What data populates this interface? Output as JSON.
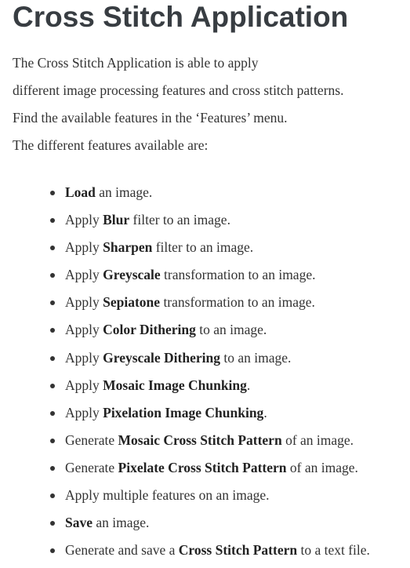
{
  "title": "Cross Stitch Application",
  "intro": [
    "The Cross Stitch Application is able to apply",
    "different image processing features and cross stitch patterns.",
    "Find the available features in the ‘Features’ menu.",
    "The different features available are:"
  ],
  "features": [
    {
      "before": "",
      "bold": "Load",
      "after": " an image."
    },
    {
      "before": "Apply ",
      "bold": "Blur",
      "after": " filter to an image."
    },
    {
      "before": "Apply ",
      "bold": "Sharpen",
      "after": " filter to an image."
    },
    {
      "before": "Apply ",
      "bold": "Greyscale",
      "after": " transformation to an image."
    },
    {
      "before": "Apply ",
      "bold": "Sepiatone",
      "after": " transformation to an image."
    },
    {
      "before": "Apply ",
      "bold": "Color Dithering",
      "after": " to an image."
    },
    {
      "before": "Apply ",
      "bold": "Greyscale Dithering",
      "after": " to an image."
    },
    {
      "before": "Apply ",
      "bold": "Mosaic Image Chunking",
      "after": "."
    },
    {
      "before": "Apply ",
      "bold": "Pixelation Image Chunking",
      "after": "."
    },
    {
      "before": "Generate ",
      "bold": "Mosaic Cross Stitch Pattern",
      "after": " of an image."
    },
    {
      "before": "Generate ",
      "bold": "Pixelate Cross Stitch Pattern",
      "after": " of an image."
    },
    {
      "before": "Apply multiple features on an image.",
      "bold": "",
      "after": ""
    },
    {
      "before": "",
      "bold": "Save",
      "after": " an image."
    },
    {
      "before": "Generate and save a ",
      "bold": "Cross Stitch Pattern",
      "after": " to a text file."
    }
  ]
}
